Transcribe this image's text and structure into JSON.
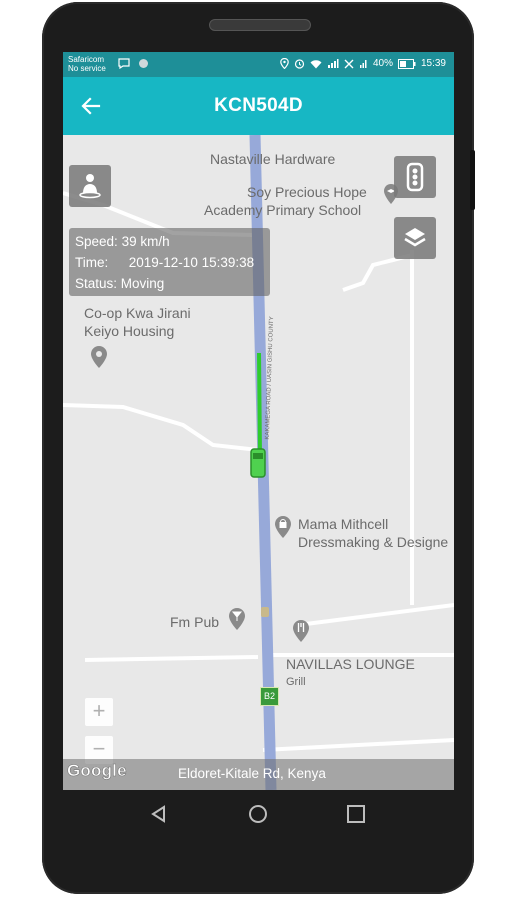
{
  "status_bar": {
    "carrier_line1": "Safaricom",
    "carrier_line2": "No service",
    "battery": "40%",
    "time": "15:39"
  },
  "app_bar": {
    "title": "KCN504D"
  },
  "info_box": {
    "speed_label": "Speed:",
    "speed_value": "39 km/h",
    "time_label": "Time:",
    "time_value": "2019-12-10 15:39:38",
    "status_label": "Status:",
    "status_value": "Moving"
  },
  "map": {
    "pois": {
      "nastaville": "Nastaville Hardware",
      "soy_line1": "Soy Precious Hope",
      "soy_line2": "Academy Primary School",
      "coop_line1": "Co-op Kwa Jirani",
      "coop_line2": "Keiyo Housing",
      "mama_line1": "Mama Mithcell",
      "mama_line2": "Dressmaking & Designe",
      "fm_pub": "Fm Pub",
      "navillas": "NAVILLAS LOUNGE",
      "navillas_sub": "Grill"
    },
    "road_label": "Eldoret-Kitale Rd, Kenya",
    "google_logo": "Google",
    "route_badge": "B2",
    "zoom_in": "+",
    "zoom_out": "−",
    "route_color": "#2ecc2e",
    "road_color": "#97a9d9"
  }
}
